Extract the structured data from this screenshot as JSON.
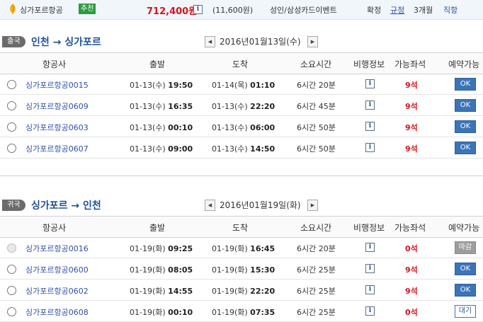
{
  "top": {
    "airline": "싱가포르항공",
    "badge": "추천",
    "price": "712,400원",
    "sub_price": "(11,600원)",
    "card_event": "성인/삼성카드이벤트",
    "confirm": "확정",
    "rule": "규정",
    "months": "3개월",
    "direct": "직항"
  },
  "columns": [
    "항공사",
    "출발",
    "도착",
    "소요시간",
    "비행정보",
    "가능좌석",
    "예약가능"
  ],
  "outbound": {
    "tag": "출국",
    "route": "인천 → 싱가포르",
    "date": "2016년01월13일(수)",
    "rows": [
      {
        "flight": "싱가포르항공0015",
        "dep_date": "01-13(수)",
        "dep_time": "19:50",
        "arr_date": "01-14(목)",
        "arr_time": "01:10",
        "duration": "6시간 20분",
        "seats": "9석",
        "action": "OK"
      },
      {
        "flight": "싱가포르항공0609",
        "dep_date": "01-13(수)",
        "dep_time": "16:35",
        "arr_date": "01-13(수)",
        "arr_time": "22:20",
        "duration": "6시간 45분",
        "seats": "9석",
        "action": "OK"
      },
      {
        "flight": "싱가포르항공0603",
        "dep_date": "01-13(수)",
        "dep_time": "00:10",
        "arr_date": "01-13(수)",
        "arr_time": "06:00",
        "duration": "6시간 50분",
        "seats": "9석",
        "action": "OK"
      },
      {
        "flight": "싱가포르항공0607",
        "dep_date": "01-13(수)",
        "dep_time": "09:00",
        "arr_date": "01-13(수)",
        "arr_time": "14:50",
        "duration": "6시간 50분",
        "seats": "9석",
        "action": "OK"
      }
    ]
  },
  "inbound": {
    "tag": "귀국",
    "route": "싱가포르 → 인천",
    "date": "2016년01월19일(화)",
    "rows": [
      {
        "flight": "싱가포르항공0016",
        "dep_date": "01-19(화)",
        "dep_time": "09:25",
        "arr_date": "01-19(화)",
        "arr_time": "16:45",
        "duration": "6시간 20분",
        "seats": "0석",
        "action": "마감"
      },
      {
        "flight": "싱가포르항공0600",
        "dep_date": "01-19(화)",
        "dep_time": "08:05",
        "arr_date": "01-19(화)",
        "arr_time": "15:30",
        "duration": "6시간 25분",
        "seats": "9석",
        "action": "OK"
      },
      {
        "flight": "싱가포르항공0602",
        "dep_date": "01-19(화)",
        "dep_time": "14:55",
        "arr_date": "01-19(화)",
        "arr_time": "22:20",
        "duration": "6시간 25분",
        "seats": "9석",
        "action": "OK"
      },
      {
        "flight": "싱가포르항공0608",
        "dep_date": "01-19(화)",
        "dep_time": "00:10",
        "arr_date": "01-19(화)",
        "arr_time": "07:35",
        "duration": "6시간 25분",
        "seats": "0석",
        "action": "대기"
      }
    ]
  },
  "icons": {
    "logo": "airline-logo-icon",
    "info": "info-icon",
    "prev": "triangle-left-icon",
    "next": "triangle-right-icon"
  },
  "colors": {
    "price": "#d4151a",
    "route": "#1f4f96",
    "link": "#2f4fa8",
    "ok_button": "#3c74b8",
    "recommend_badge": "#2e9a3f"
  }
}
